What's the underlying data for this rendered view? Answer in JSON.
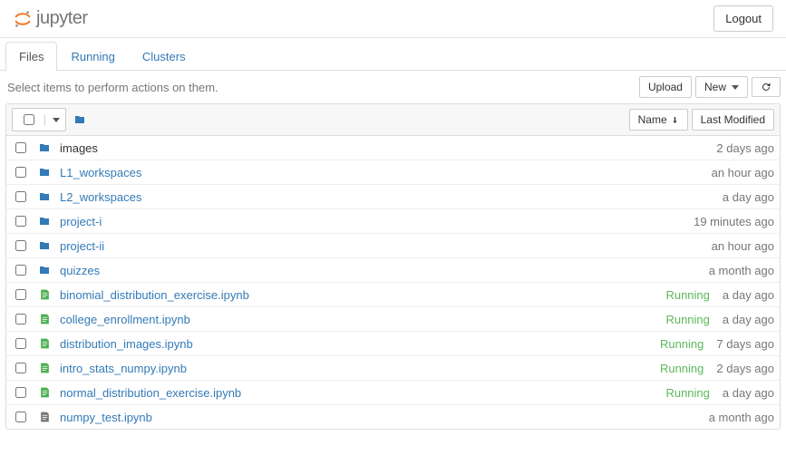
{
  "header": {
    "brand": "jupyter",
    "logout": "Logout"
  },
  "tabs": {
    "files": "Files",
    "running": "Running",
    "clusters": "Clusters"
  },
  "toolbar": {
    "hint": "Select items to perform actions on them.",
    "upload": "Upload",
    "new": "New",
    "sort_name": "Name",
    "sort_modified": "Last Modified"
  },
  "colors": {
    "link": "#337ab7",
    "running": "#5cb85c",
    "folder": "#337ab7",
    "nb_running": "#4caf50",
    "nb_idle": "#777"
  },
  "rows": [
    {
      "type": "folder",
      "name": "images",
      "modified": "2 days ago"
    },
    {
      "type": "folder",
      "name": "L1_workspaces",
      "modified": "an hour ago"
    },
    {
      "type": "folder",
      "name": "L2_workspaces",
      "modified": "a day ago"
    },
    {
      "type": "folder",
      "name": "project-i",
      "modified": "19 minutes ago"
    },
    {
      "type": "folder",
      "name": "project-ii",
      "modified": "an hour ago"
    },
    {
      "type": "folder",
      "name": "quizzes",
      "modified": "a month ago"
    },
    {
      "type": "notebook",
      "name": "binomial_distribution_exercise.ipynb",
      "status": "Running",
      "modified": "a day ago"
    },
    {
      "type": "notebook",
      "name": "college_enrollment.ipynb",
      "status": "Running",
      "modified": "a day ago"
    },
    {
      "type": "notebook",
      "name": "distribution_images.ipynb",
      "status": "Running",
      "modified": "7 days ago"
    },
    {
      "type": "notebook",
      "name": "intro_stats_numpy.ipynb",
      "status": "Running",
      "modified": "2 days ago"
    },
    {
      "type": "notebook",
      "name": "normal_distribution_exercise.ipynb",
      "status": "Running",
      "modified": "a day ago"
    },
    {
      "type": "notebook",
      "name": "numpy_test.ipynb",
      "status": "",
      "modified": "a month ago"
    }
  ]
}
